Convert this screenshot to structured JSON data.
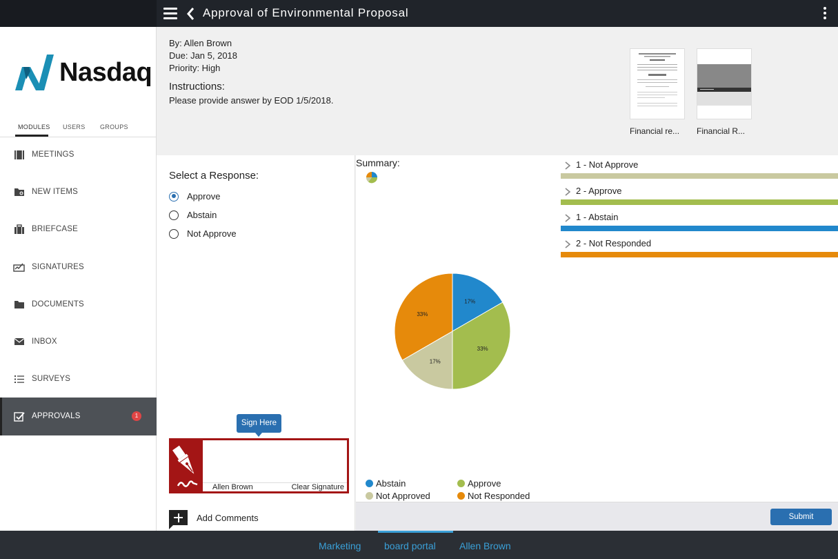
{
  "header": {
    "title": "Approval of Environmental Proposal",
    "menu_icon": "hamburger-icon",
    "back_icon": "chevron-left-icon",
    "more_icon": "kebab-icon"
  },
  "sidebar": {
    "logo_text": "Nasdaq",
    "tabs": [
      {
        "label": "MODULES"
      },
      {
        "label": "USERS"
      },
      {
        "label": "GROUPS"
      }
    ],
    "items": [
      {
        "label": "MEETINGS",
        "icon": "meetings-icon"
      },
      {
        "label": "NEW ITEMS",
        "icon": "new-items-icon"
      },
      {
        "label": "BRIEFCASE",
        "icon": "briefcase-icon"
      },
      {
        "label": "SIGNATURES",
        "icon": "signature-icon"
      },
      {
        "label": "DOCUMENTS",
        "icon": "folder-icon"
      },
      {
        "label": "INBOX",
        "icon": "envelope-icon"
      },
      {
        "label": "SURVEYS",
        "icon": "list-icon"
      },
      {
        "label": "APPROVALS",
        "icon": "checkbox-icon",
        "badge": "1"
      }
    ]
  },
  "info": {
    "by": "By: Allen Brown",
    "due": "Due: Jan 5, 2018",
    "priority": "Priority: High",
    "instructions_title": "Instructions:",
    "instructions_text": "Please provide answer by EOD 1/5/2018.",
    "attachments": [
      {
        "label": "Financial re..."
      },
      {
        "label": "Financial R..."
      }
    ]
  },
  "response": {
    "title": "Select a Response:",
    "options": [
      {
        "label": "Approve",
        "checked": true
      },
      {
        "label": "Abstain",
        "checked": false
      },
      {
        "label": "Not Approve",
        "checked": false
      }
    ],
    "sign_tip": "Sign Here",
    "signer_name": "Allen Brown",
    "clear_signature": "Clear Signature",
    "add_comments": "Add Comments"
  },
  "summary": {
    "title": "Summary:",
    "results": [
      {
        "label": "1 - Not Approve",
        "color": "#c9c9a0"
      },
      {
        "label": "2 - Approve",
        "color": "#a3bd4e"
      },
      {
        "label": "1 - Abstain",
        "color": "#2188cc"
      },
      {
        "label": "2 - Not Responded",
        "color": "#e68a0b"
      }
    ],
    "submit_label": "Submit"
  },
  "chart_data": {
    "type": "pie",
    "slices": [
      {
        "name": "Abstain",
        "value": 1,
        "label": "17%",
        "color": "#2188cc"
      },
      {
        "name": "Approve",
        "value": 2,
        "label": "33%",
        "color": "#a3bd4e"
      },
      {
        "name": "Not Approved",
        "value": 1,
        "label": "17%",
        "color": "#c9c9a0"
      },
      {
        "name": "Not Responded",
        "value": 2,
        "label": "33%",
        "color": "#e68a0b"
      }
    ],
    "legend": [
      "Abstain",
      "Approve",
      "Not Approved",
      "Not Responded"
    ],
    "legend_position": "bottom"
  },
  "footer": {
    "items": [
      {
        "label": "Marketing"
      },
      {
        "label": "board portal"
      },
      {
        "label": "Allen Brown"
      }
    ]
  }
}
